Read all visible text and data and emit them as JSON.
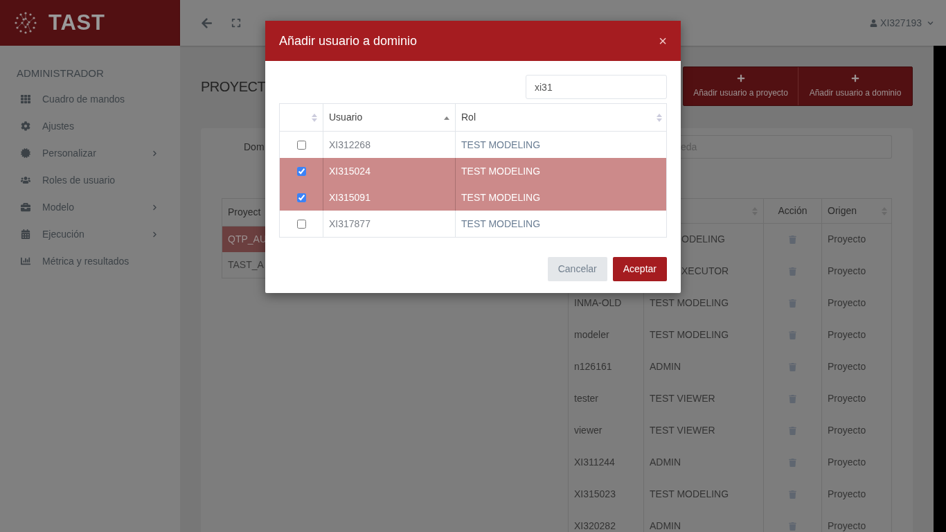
{
  "app": {
    "name": "TAST"
  },
  "sidebar": {
    "section": "ADMINISTRADOR",
    "items": [
      {
        "label": "Cuadro de mandos",
        "submenu": false
      },
      {
        "label": "Ajustes",
        "submenu": false
      },
      {
        "label": "Personalizar",
        "submenu": true
      },
      {
        "label": "Roles de usuario",
        "submenu": false
      },
      {
        "label": "Modelo",
        "submenu": true
      },
      {
        "label": "Ejecución",
        "submenu": true
      },
      {
        "label": "Métrica y resultados",
        "submenu": false
      }
    ]
  },
  "topbar": {
    "user": "XI327193"
  },
  "page": {
    "title": "PROYECT",
    "buttons": [
      "Añadir usuario a proyecto",
      "Añadir usuario a dominio"
    ],
    "filter_label": "Dom",
    "search": {
      "placeholder": "eda"
    },
    "projects": {
      "header": "Proyect",
      "rows": [
        {
          "name": "QTP_AU",
          "selected": true
        },
        {
          "name": "TAST_A",
          "selected": false
        }
      ]
    },
    "users": {
      "columns": [
        {
          "sorted": false
        },
        {
          "label": "Acción"
        },
        {
          "label": "Origen",
          "sorted": false
        }
      ],
      "rows": [
        {
          "rol": "ODELING",
          "origen": "Proyecto"
        },
        {
          "rol": "XECUTOR",
          "origen": "Proyecto"
        },
        {
          "user": "INMA-OLD",
          "rol": "TEST MODELING",
          "origen": "Proyecto"
        },
        {
          "user": "modeler",
          "rol": "TEST MODELING",
          "origen": "Proyecto"
        },
        {
          "user": "n126161",
          "rol": "ADMIN",
          "origen": "Proyecto"
        },
        {
          "user": "tester",
          "rol": "TEST VIEWER",
          "origen": "Proyecto"
        },
        {
          "user": "viewer",
          "rol": "TEST VIEWER",
          "origen": "Proyecto"
        },
        {
          "user": "XI311244",
          "rol": "ADMIN",
          "origen": "Proyecto"
        },
        {
          "user": "XI315023",
          "rol": "TEST MODELING",
          "origen": "Proyecto"
        },
        {
          "user": "XI320282",
          "rol": "ADMIN",
          "origen": "Proyecto"
        }
      ]
    }
  },
  "modal": {
    "title": "Añadir usuario a dominio",
    "close": "×",
    "search": {
      "value": "xi31"
    },
    "columns": [
      {
        "sorted": false
      },
      {
        "label": "Usuario",
        "sorted": true
      },
      {
        "label": "Rol",
        "sorted": false
      }
    ],
    "rows": [
      {
        "user": "XI312268",
        "rol": "TEST MODELING",
        "selected": false
      },
      {
        "user": "XI315024",
        "rol": "TEST MODELING",
        "selected": true
      },
      {
        "user": "XI315091",
        "rol": "TEST MODELING",
        "selected": true
      },
      {
        "user": "XI317877",
        "rol": "TEST MODELING",
        "selected": false
      }
    ],
    "buttons": {
      "cancel": "Cancelar",
      "accept": "Aceptar"
    }
  }
}
